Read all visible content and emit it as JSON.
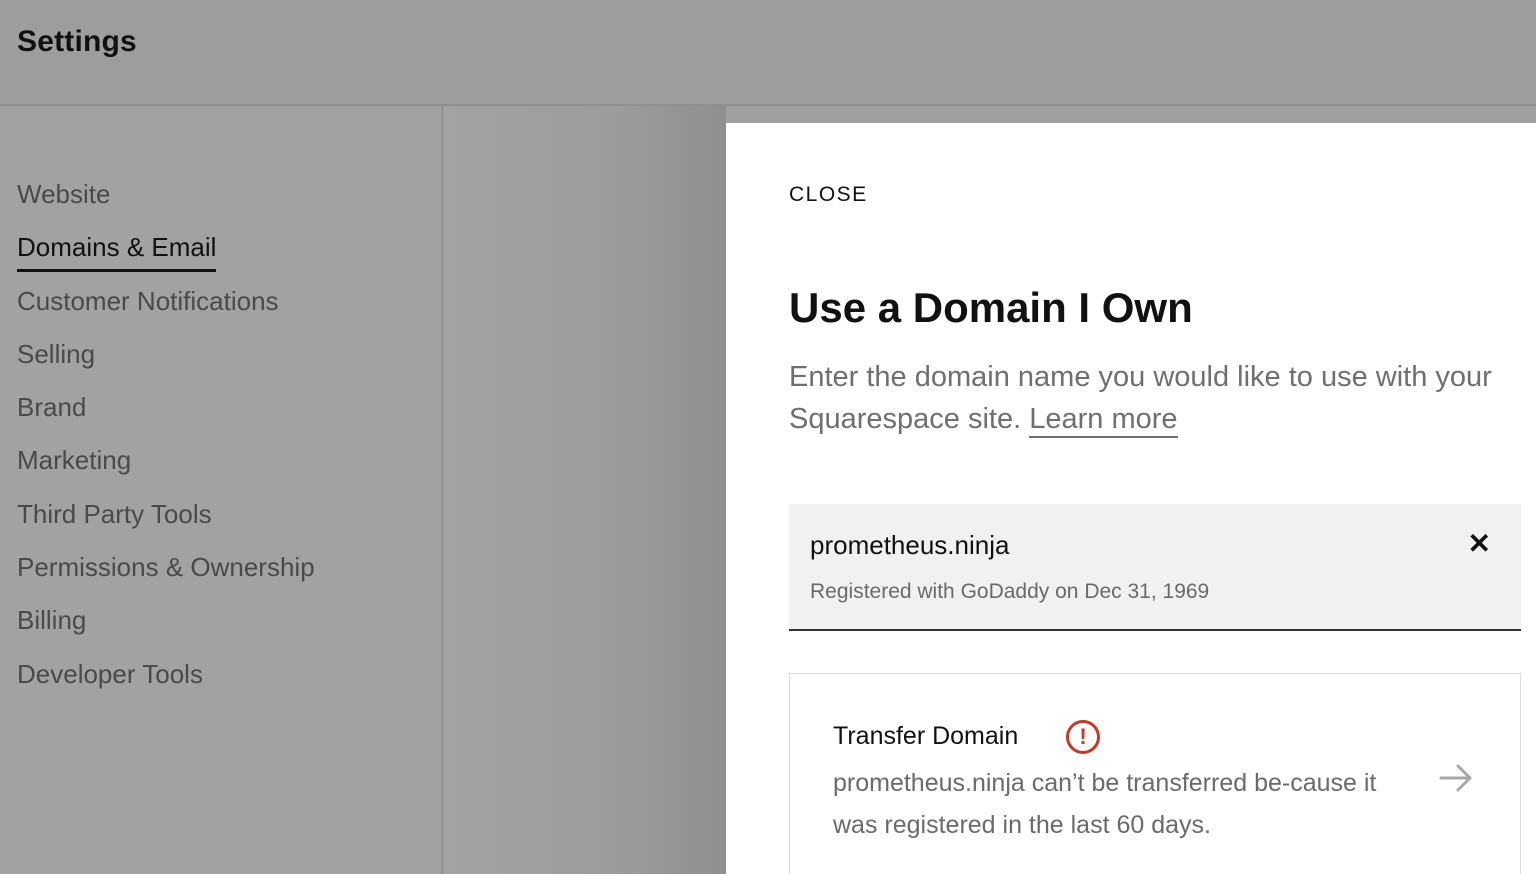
{
  "header": {
    "title": "Settings"
  },
  "sidebar": {
    "items": [
      {
        "label": "Website",
        "active": false
      },
      {
        "label": "Domains & Email",
        "active": true
      },
      {
        "label": "Customer Notifications",
        "active": false
      },
      {
        "label": "Selling",
        "active": false
      },
      {
        "label": "Brand",
        "active": false
      },
      {
        "label": "Marketing",
        "active": false
      },
      {
        "label": "Third Party Tools",
        "active": false
      },
      {
        "label": "Permissions & Ownership",
        "active": false
      },
      {
        "label": "Billing",
        "active": false
      },
      {
        "label": "Developer Tools",
        "active": false
      }
    ]
  },
  "modal": {
    "close_label": "CLOSE",
    "title": "Use a Domain I Own",
    "description": "Enter the domain name you would like to use with your Squarespace site.",
    "learn_more": "Learn more",
    "domain": {
      "name": "prometheus.ninja",
      "registration": "Registered with GoDaddy on Dec 31, 1969",
      "clear_icon": "close-icon"
    },
    "transfer": {
      "title": "Transfer Domain",
      "warning_icon": "exclamation-circle-icon",
      "description": "prometheus.ninja can’t be transferred be-cause it was registered in the last 60 days.",
      "arrow_icon": "arrow-right-icon"
    }
  },
  "colors": {
    "warning": "#c0392b",
    "overlay": "#a0a0a0"
  }
}
